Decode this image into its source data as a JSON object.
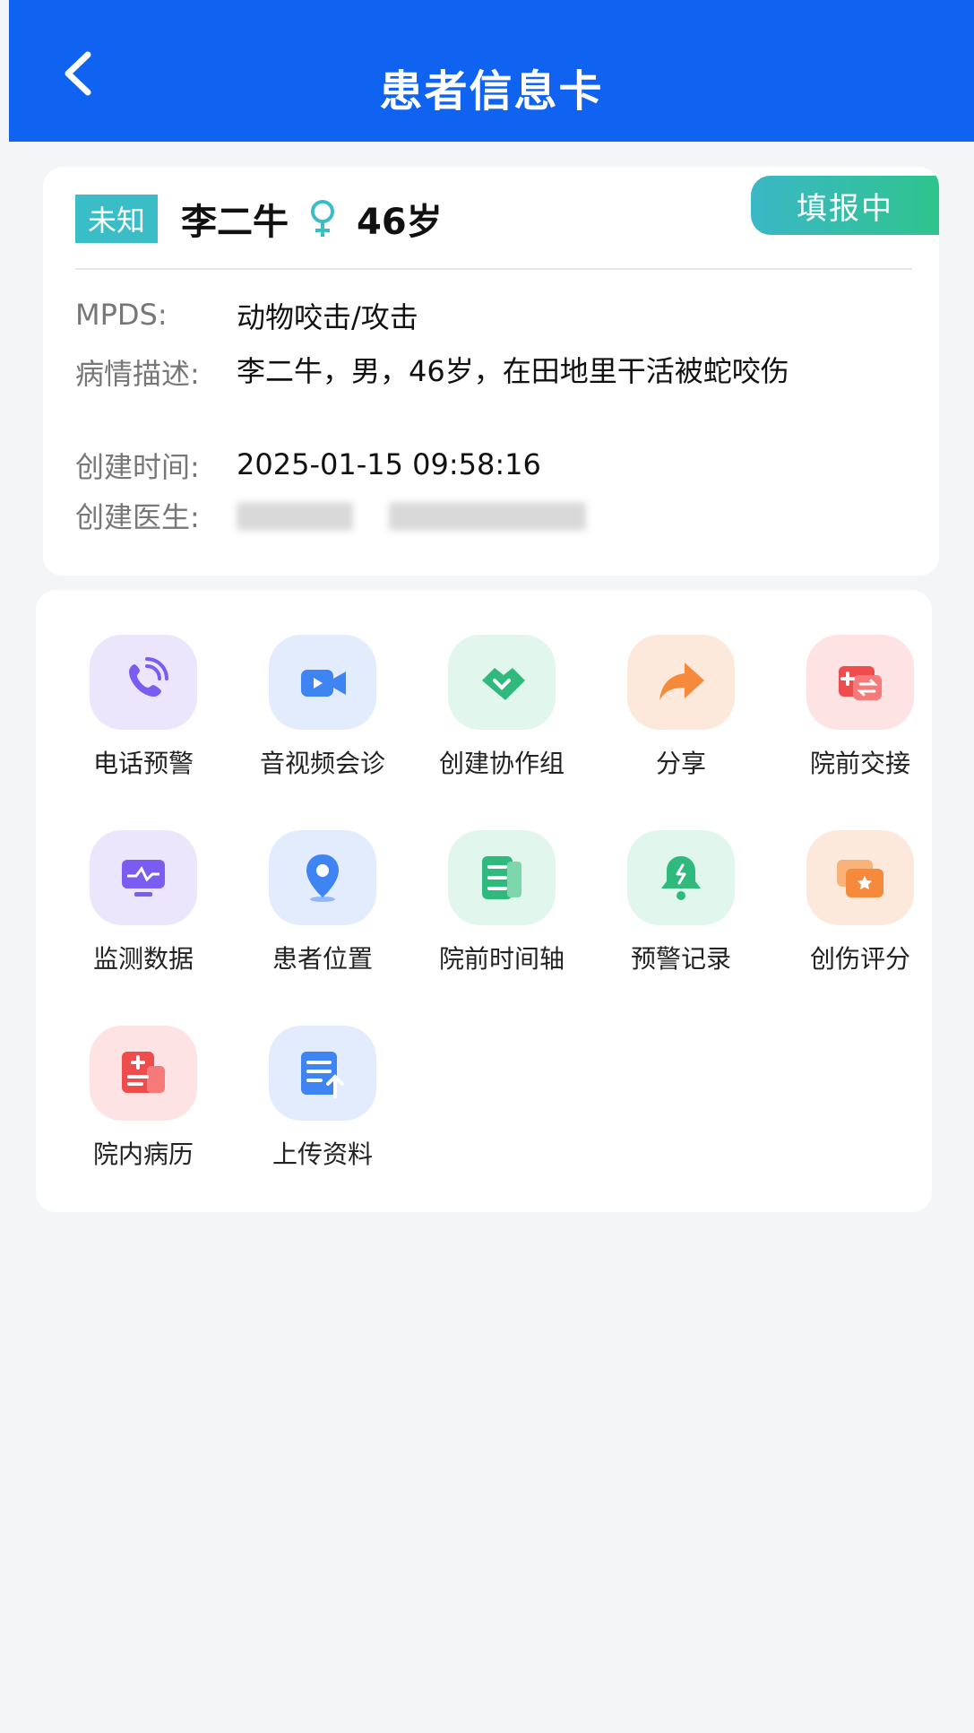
{
  "header": {
    "title": "患者信息卡"
  },
  "patient": {
    "tag": "未知",
    "name": "李二牛",
    "age": "46岁",
    "status": "填报中"
  },
  "info": {
    "mpds_label": "MPDS:",
    "mpds_value": "动物咬击/攻击",
    "desc_label": "病情描述:",
    "desc_value": "李二牛，男，46岁，在田地里干活被蛇咬伤",
    "time_label": "创建时间:",
    "time_value": "2025-01-15 09:58:16",
    "doctor_label": "创建医生:"
  },
  "actions": [
    {
      "label": "电话预警",
      "icon": "phone-icon",
      "bg": "#ebe6fb",
      "fg": "#7b5cf0"
    },
    {
      "label": "音视频会诊",
      "icon": "video-camera-icon",
      "bg": "#e3ecfd",
      "fg": "#3e84f2"
    },
    {
      "label": "创建协作组",
      "icon": "handshake-icon",
      "bg": "#e1f6ec",
      "fg": "#2fb97c"
    },
    {
      "label": "分享",
      "icon": "share-arrow-icon",
      "bg": "#fde9dc",
      "fg": "#f58a3c"
    },
    {
      "label": "院前交接",
      "icon": "medical-transfer-icon",
      "bg": "#fde3e3",
      "fg": "#ef4d4d"
    },
    {
      "label": "监测数据",
      "icon": "monitor-icon",
      "bg": "#ebe6fb",
      "fg": "#7b5cf0"
    },
    {
      "label": "患者位置",
      "icon": "location-pin-icon",
      "bg": "#e3ecfd",
      "fg": "#3e84f2"
    },
    {
      "label": "院前时间轴",
      "icon": "timeline-list-icon",
      "bg": "#e1f6ec",
      "fg": "#2fb97c"
    },
    {
      "label": "预警记录",
      "icon": "alarm-bell-icon",
      "bg": "#e1f6ec",
      "fg": "#2fb97c"
    },
    {
      "label": "创伤评分",
      "icon": "score-card-icon",
      "bg": "#fde9dc",
      "fg": "#f58a3c"
    },
    {
      "label": "院内病历",
      "icon": "medical-record-icon",
      "bg": "#fde3e3",
      "fg": "#ef4d4d"
    },
    {
      "label": "上传资料",
      "icon": "upload-document-icon",
      "bg": "#e3ecfd",
      "fg": "#3e84f2"
    }
  ],
  "colors": {
    "header": "#0f63f0",
    "status": "#2fc48d",
    "tag": "#3bbdc8"
  }
}
